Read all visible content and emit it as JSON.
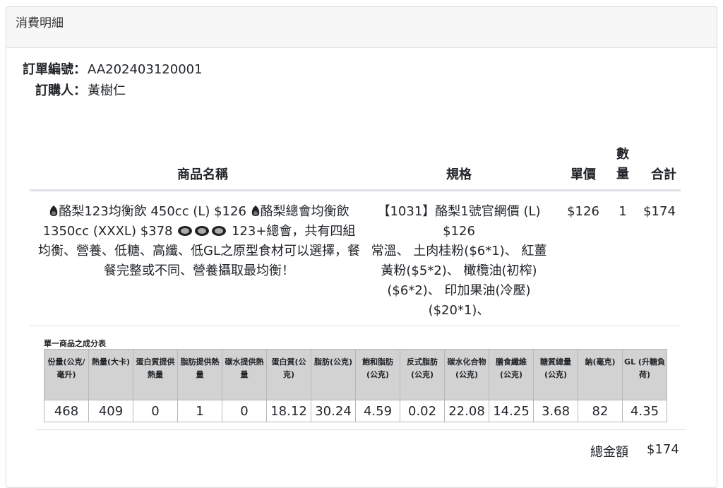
{
  "card": {
    "title": "消費明細"
  },
  "order": {
    "number_label": "訂單編號：",
    "number": "AA202403120001",
    "buyer_label": "訂購人：",
    "buyer": "黃樹仁"
  },
  "table": {
    "headers": {
      "name": "商品名稱",
      "spec": "規格",
      "price": "單價",
      "qty_1": "數",
      "qty_2": "量",
      "total": "合計"
    },
    "row": {
      "name_part1": "酪梨123均衡飲 450cc (L) $126 ",
      "name_part2": "酪梨總會均衡飲 1350cc (XXXL) $378 ",
      "name_part3": " 123+總會，共有四組均衡、營養、低糖、高纖、低GL之原型食材可以選擇，餐餐完整或不同、營養攝取最均衡！",
      "spec_1": "【1031】酪梨1號官網價 (L) $126",
      "spec_2": "常溫、 土肉桂粉($6*1)、 紅薑黃粉($5*2)、 橄欖油(初榨)($6*2)、 印加果油(冷壓)($20*1)、",
      "price": "$126",
      "qty": "1",
      "total": "$174"
    }
  },
  "nutrition": {
    "title": "單一商品之成分表",
    "headers": [
      "份量(公克/毫升)",
      "熱量(大卡)",
      "蛋白質提供熱量",
      "脂肪提供熱量",
      "碳水提供熱量",
      "蛋白質(公克)",
      "脂肪(公克)",
      "飽和脂肪(公克)",
      "反式脂肪(公克)",
      "碳水化合物(公克)",
      "膳食纖維(公克)",
      "糖質總量(公克)",
      "鈉(毫克)",
      "GL (升糖負荷)"
    ],
    "values": [
      "468",
      "409",
      "0",
      "1",
      "0",
      "18.12",
      "30.24",
      "4.59",
      "0.02",
      "22.08",
      "14.25",
      "3.68",
      "82",
      "4.35"
    ]
  },
  "summary": {
    "label": "總金額",
    "value": "$174"
  },
  "icons": {
    "avocado": "avocado-icon",
    "shoe": "shoe-icon"
  }
}
